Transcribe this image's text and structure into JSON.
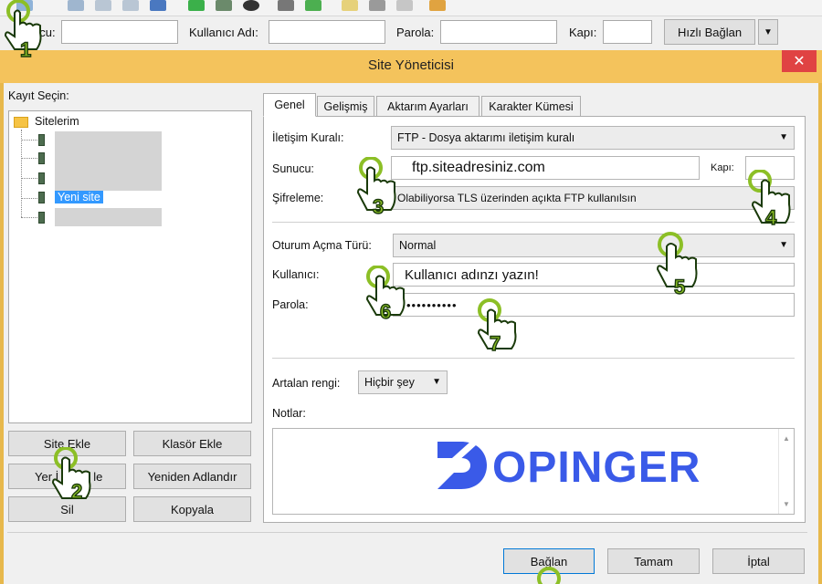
{
  "quickconnect": {
    "host_label_partial": "ucu:",
    "username_label": "Kullanıcı Adı:",
    "password_label": "Parola:",
    "port_label": "Kapı:",
    "connect_button": "Hızlı Bağlan",
    "dropdown_arrow": "▼"
  },
  "dialog": {
    "title": "Site Yöneticisi",
    "close_label": "✕",
    "select_entry_label": "Kayıt Seçin:",
    "tree": {
      "root": "Sitelerim",
      "new_site": "Yeni site"
    },
    "left_buttons": {
      "new_site": "Site Ekle",
      "new_folder": "Klasör Ekle",
      "new_bookmark_partial": "Yer İ",
      "new_bookmark_suffix": "le",
      "rename": "Yeniden Adlandır",
      "delete_partial": "Sil",
      "copy": "Kopyala"
    },
    "tabs": [
      "Genel",
      "Gelişmiş",
      "Aktarım Ayarları",
      "Karakter Kümesi"
    ],
    "general": {
      "protocol_label": "İletişim Kuralı:",
      "protocol_value": "FTP - Dosya aktarımı iletişim kuralı",
      "host_label": "Sunucu:",
      "host_value": "ftp.siteadresiniz.com",
      "port_label": "Kapı:",
      "port_value": "",
      "encryption_label": "Şifreleme:",
      "encryption_value": "Olabiliyorsa TLS üzerinden açıkta FTP kullanılsın",
      "logon_type_label": "Oturum Açma Türü:",
      "logon_type_value": "Normal",
      "user_label": "Kullanıcı:",
      "user_value": "Kullanıcı adınzı yazın!",
      "password_label": "Parola:",
      "password_value": "••••••••••",
      "background_color_label": "Artalan rengi:",
      "background_color_value": "Hiçbir şey",
      "notes_label": "Notlar:"
    },
    "bottom_buttons": {
      "connect": "Bağlan",
      "ok": "Tamam",
      "cancel": "İptal"
    }
  },
  "watermark": {
    "brand": "OPINGER",
    "brand_full": "DOPINGER",
    "color": "#3a5ae8"
  },
  "step_badges": [
    "1",
    "2",
    "3",
    "4",
    "5",
    "6",
    "7"
  ],
  "colors": {
    "title_bar": "#f4c35c",
    "badge": "#8cbf26",
    "selection": "#3399ff"
  }
}
